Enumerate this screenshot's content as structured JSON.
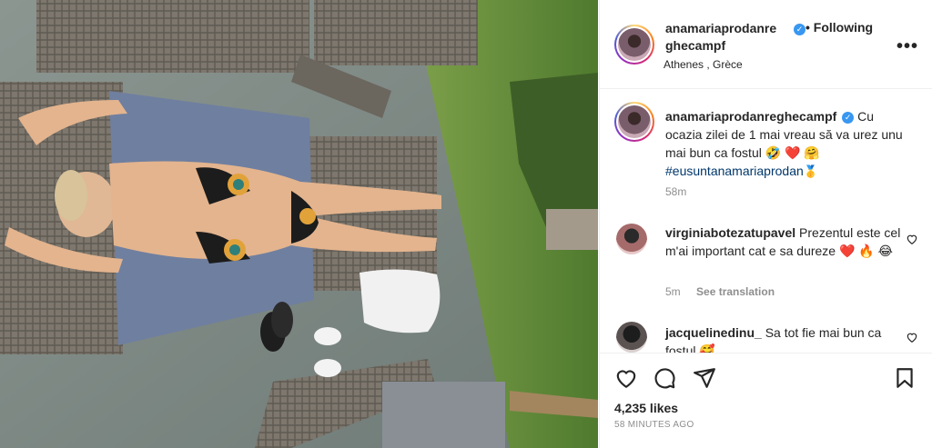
{
  "post": {
    "author": "anamariaprodanreghecampf",
    "author_line1": "anamariaprodanre",
    "author_line2": "ghecampf",
    "follow_status": "• Following",
    "location": "Athenes , Grèce",
    "more_icon": "more-horizontal-icon",
    "verified_icon": "verified-badge-icon"
  },
  "caption": {
    "author": "anamariaprodanreghecampf",
    "text": "Cu ocazia zilei de 1 mai vreau să va urez unu mai bun ca fostul 🤣 ❤️ 🤗",
    "hashtag": "#eusuntanamariaprodan",
    "hashtag_emoji": "🥇",
    "time": "58m"
  },
  "comments": [
    {
      "author": "virginiabotezatupavel",
      "text": "Prezentul este cel m'ai important cat e sa dureze ❤️ 🔥 😂",
      "time": "5m",
      "translate_label": "See translation"
    },
    {
      "author": "jacquelinedinu_",
      "text": "Sa tot fie mai bun ca fostul 🥰"
    }
  ],
  "actions": {
    "like_icon": "heart-icon",
    "comment_icon": "comment-icon",
    "share_icon": "paper-plane-icon",
    "save_icon": "bookmark-icon"
  },
  "likes": "4,235 likes",
  "time_ago": "58 MINUTES AGO",
  "colors": {
    "link": "#00376b",
    "verified": "#3897f0",
    "heart_red": "#ed4956",
    "secondary_text": "#8e8e8e"
  }
}
